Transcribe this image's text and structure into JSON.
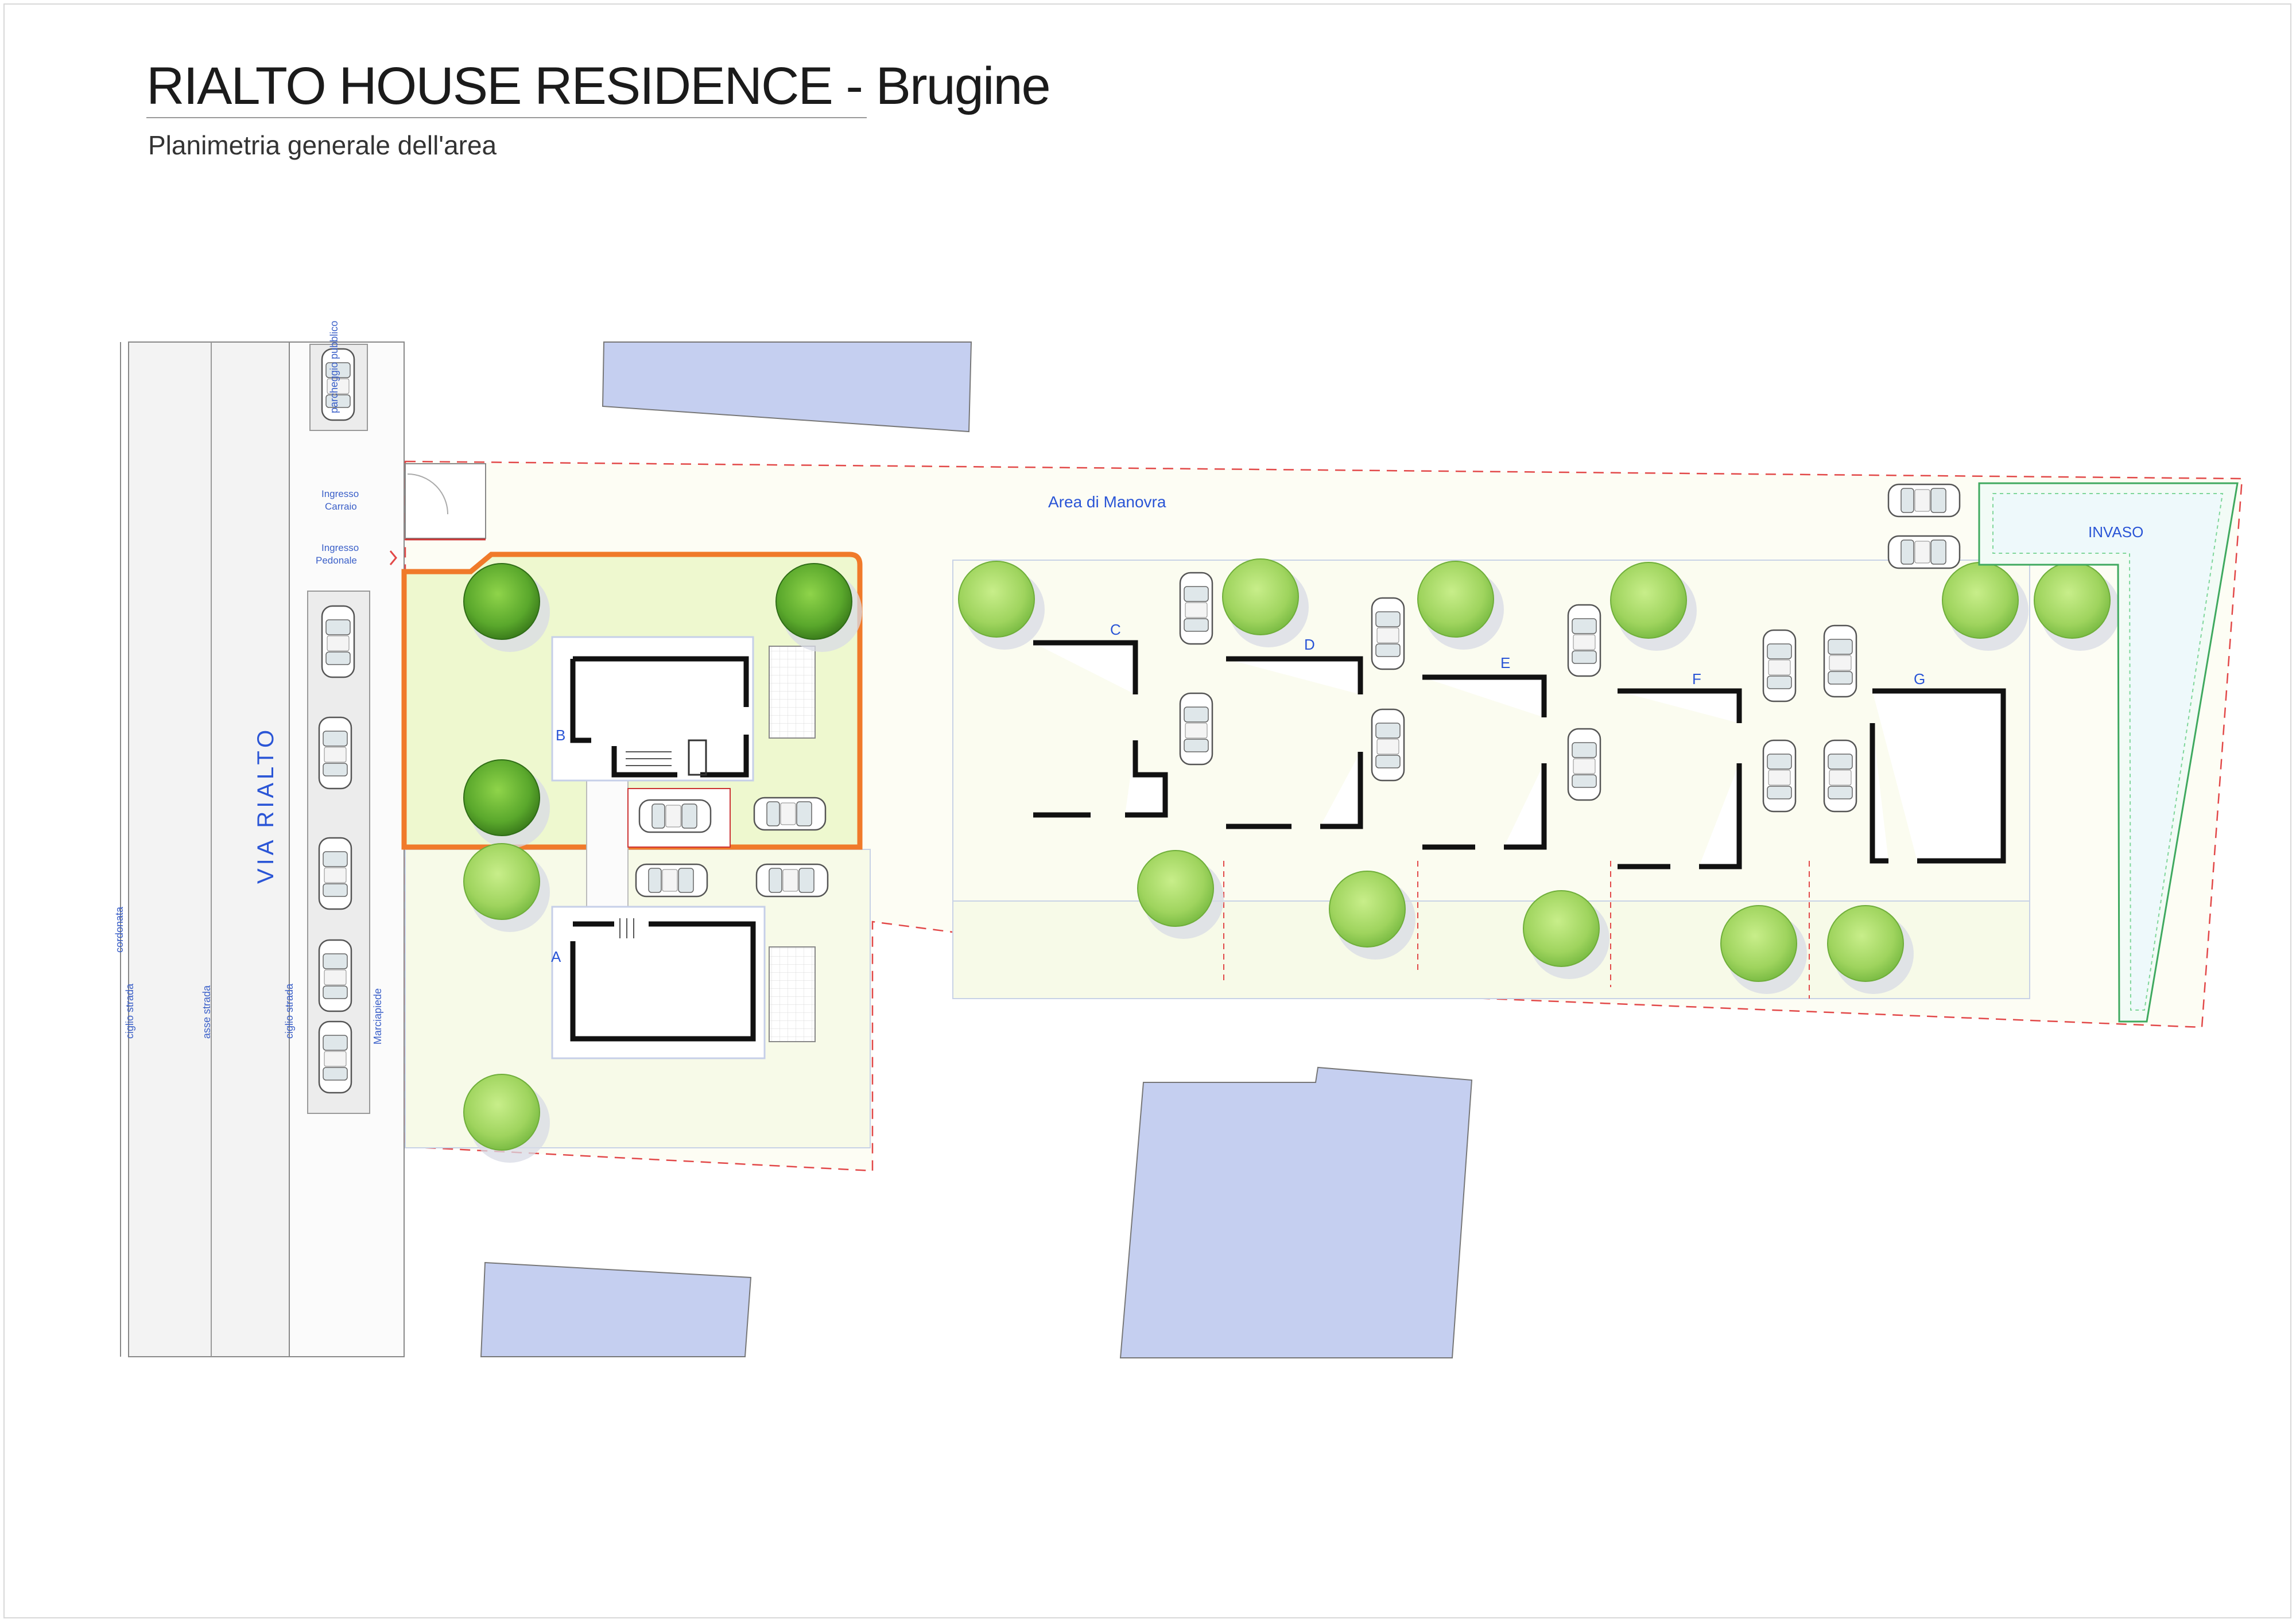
{
  "header": {
    "title": "RIALTO HOUSE RESIDENCE - Brugine",
    "subtitle": "Planimetria generale dell'area"
  },
  "street": {
    "name": "VIA RIALTO",
    "cordonata": "cordonata",
    "ciglio_left": "ciglio strada",
    "asse": "asse strada",
    "ciglio_right": "ciglio strada",
    "marciapiede": "Marciapiede",
    "parcheggio": "parcheggio pubblico"
  },
  "entrances": {
    "carraio_1": "Ingresso",
    "carraio_2": "Carraio",
    "pedonale_1": "Ingresso",
    "pedonale_2": "Pedonale"
  },
  "areas": {
    "manovra": "Area di Manovra",
    "invaso": "INVASO"
  },
  "units": [
    "A",
    "B",
    "C",
    "D",
    "E",
    "F",
    "G"
  ],
  "colors": {
    "neighbor_building": "#c5cff0",
    "highlight_outline": "#f07a2a",
    "lot_fill": "#f7fae8",
    "tree_light": "#a8dc6a",
    "tree_dark": "#4f9a2a",
    "label_blue": "#2a55d6",
    "invaso_green": "#4fbf6f"
  }
}
